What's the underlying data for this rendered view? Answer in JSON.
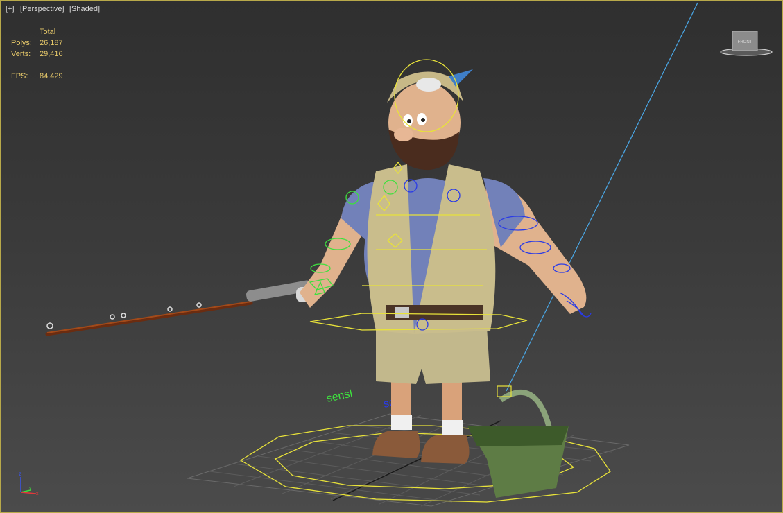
{
  "viewport": {
    "menu_plus": "[+]",
    "view_name": "[Perspective]",
    "shading_mode": "[Shaded]",
    "border_color": "#b8a94a"
  },
  "stats": {
    "column_header": "Total",
    "polys_label": "Polys:",
    "polys_value": "26,187",
    "verts_label": "Verts:",
    "verts_value": "29,416",
    "fps_label": "FPS:",
    "fps_value": "84.429",
    "text_color": "#e7c96a"
  },
  "viewcube": {
    "face_label": "FRONT",
    "icon": "viewcube-icon"
  },
  "axis_tripod": {
    "x": "x",
    "y": "y",
    "z": "z"
  },
  "scene": {
    "ground_text_left": "sensI",
    "ground_text_right": "sensI",
    "character": "fisherman-character",
    "props": [
      "fishing-rod",
      "green-basket"
    ],
    "rig_colors": {
      "left": "#3ee03e",
      "right": "#2233dd",
      "center": "#e8e23a",
      "light": "#4aa8e8"
    }
  }
}
